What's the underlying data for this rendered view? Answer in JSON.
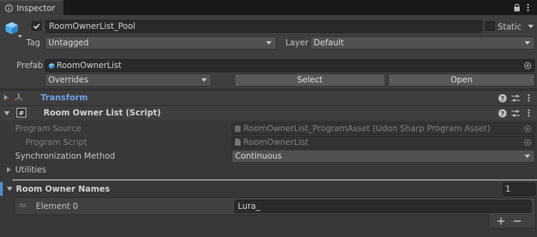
{
  "tab": {
    "title": "Inspector"
  },
  "object": {
    "name": "RoomOwnerList_Pool",
    "static_label": "Static",
    "tag_label": "Tag",
    "tag_value": "Untagged",
    "layer_label": "Layer",
    "layer_value": "Default",
    "prefab_label": "Prefab",
    "prefab_value": "RoomOwnerList",
    "overrides_value": "Overrides",
    "select_label": "Select",
    "open_label": "Open"
  },
  "components": {
    "transform_title": "Transform",
    "script_title": "Room Owner List (Script)"
  },
  "script": {
    "program_source_label": "Program Source",
    "program_source_value": "RoomOwnerList_ProgramAsset (Udon Sharp Program Asset)",
    "program_script_label": "Program Script",
    "program_script_value": "RoomOwnerList",
    "sync_label": "Synchronization Method",
    "sync_value": "Continuous",
    "utilities_label": "Utilities"
  },
  "list": {
    "title": "Room Owner Names",
    "count": "1",
    "items": [
      {
        "label": "Element 0",
        "value": "Lura_"
      }
    ],
    "add_label": "+",
    "remove_label": "−"
  },
  "colors": {
    "accent": "#4d8ed4",
    "transform_title": "#6fa0e6",
    "background": "#383838"
  }
}
